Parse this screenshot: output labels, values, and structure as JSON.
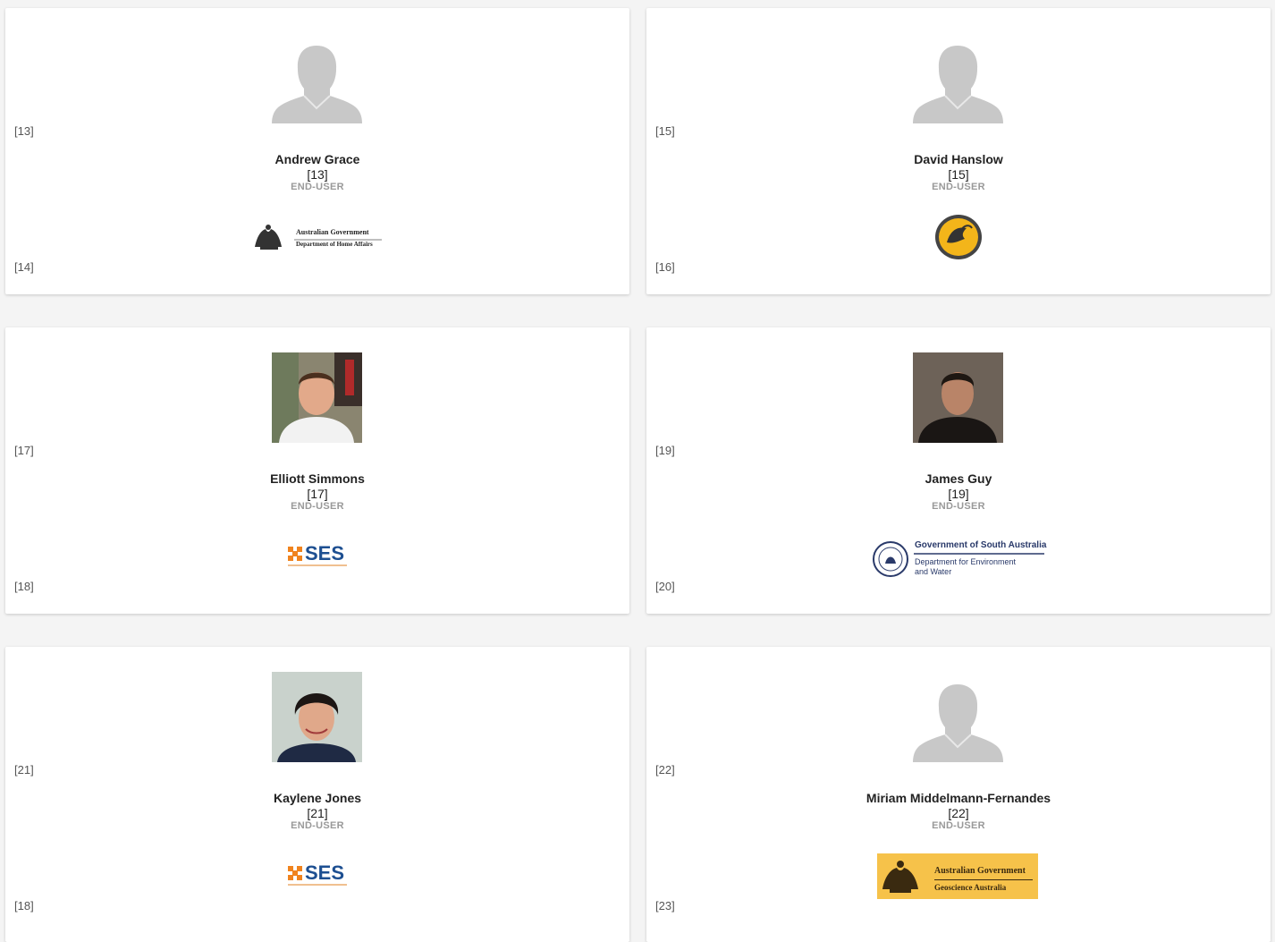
{
  "cards": [
    {
      "avatar_ref": "[13]",
      "name": "Andrew Grace",
      "id": "[13]",
      "role": "END-USER",
      "logo_ref": "[14]",
      "avatar": "placeholder-silhouette",
      "logo": {
        "kind": "aus-gov",
        "line1": "Australian Government",
        "line2": "Department of Home Affairs"
      }
    },
    {
      "avatar_ref": "[15]",
      "name": "David Hanslow",
      "id": "[15]",
      "role": "END-USER",
      "logo_ref": "[16]",
      "avatar": "placeholder-silhouette",
      "logo": {
        "kind": "nsw-parks-emblem"
      }
    },
    {
      "avatar_ref": "[17]",
      "name": "Elliott Simmons",
      "id": "[17]",
      "role": "END-USER",
      "logo_ref": "[18]",
      "avatar": "photo",
      "logo": {
        "kind": "ses",
        "text": "SES"
      }
    },
    {
      "avatar_ref": "[19]",
      "name": "James Guy",
      "id": "[19]",
      "role": "END-USER",
      "logo_ref": "[20]",
      "avatar": "photo",
      "logo": {
        "kind": "sa-gov",
        "line1": "Government of South Australia",
        "line2": "Department for Environment",
        "line3": "and Water"
      }
    },
    {
      "avatar_ref": "[21]",
      "name": "Kaylene Jones",
      "id": "[21]",
      "role": "END-USER",
      "logo_ref": "[18]",
      "avatar": "photo",
      "logo": {
        "kind": "ses",
        "text": "SES"
      }
    },
    {
      "avatar_ref": "[22]",
      "name": "Miriam Middelmann-Fernandes",
      "id": "[22]",
      "role": "END-USER",
      "logo_ref": "[23]",
      "avatar": "placeholder-silhouette",
      "logo": {
        "kind": "aus-gov-gold",
        "line1": "Australian Government",
        "line2": "Geoscience Australia"
      }
    }
  ],
  "colors": {
    "role_text": "#999999",
    "ses_orange": "#f0831e",
    "ses_blue": "#1d4f91",
    "geoscience_gold": "#f6c24a"
  }
}
